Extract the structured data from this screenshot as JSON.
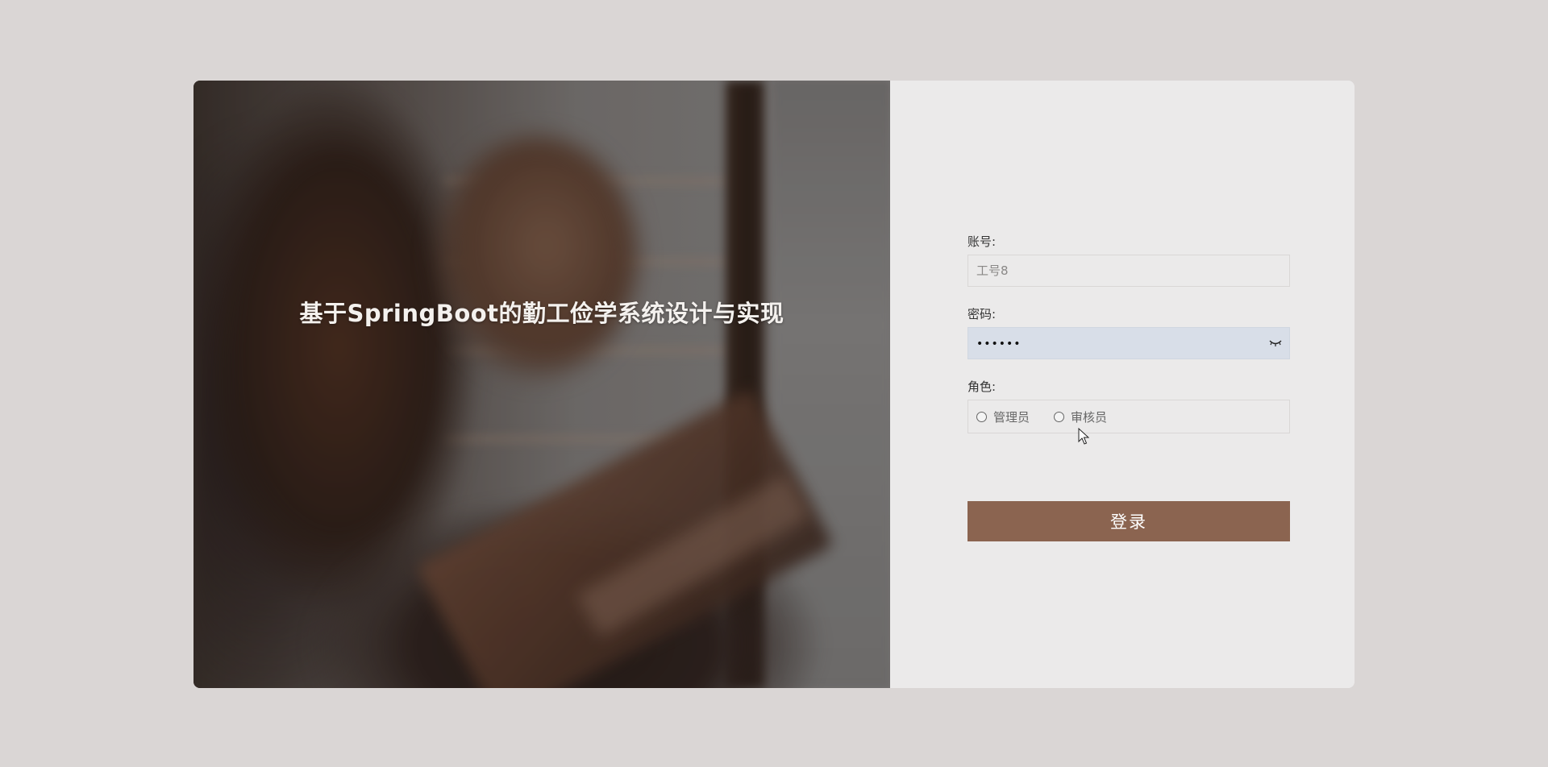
{
  "hero": {
    "title": "基于SpringBoot的勤工俭学系统设计与实现"
  },
  "form": {
    "account": {
      "label": "账号:",
      "placeholder": "工号8",
      "value": ""
    },
    "password": {
      "label": "密码:",
      "masked_value": "••••••",
      "visibility_icon": "eye-closed-icon"
    },
    "role": {
      "label": "角色:",
      "options": [
        "管理员",
        "审核员"
      ],
      "selected": null
    },
    "submit_label": "登录"
  },
  "colors": {
    "page_background": "#dad6d5",
    "panel_background": "#ebeaea",
    "button": "#8b6450",
    "password_field_autofill": "#d8dee8"
  }
}
